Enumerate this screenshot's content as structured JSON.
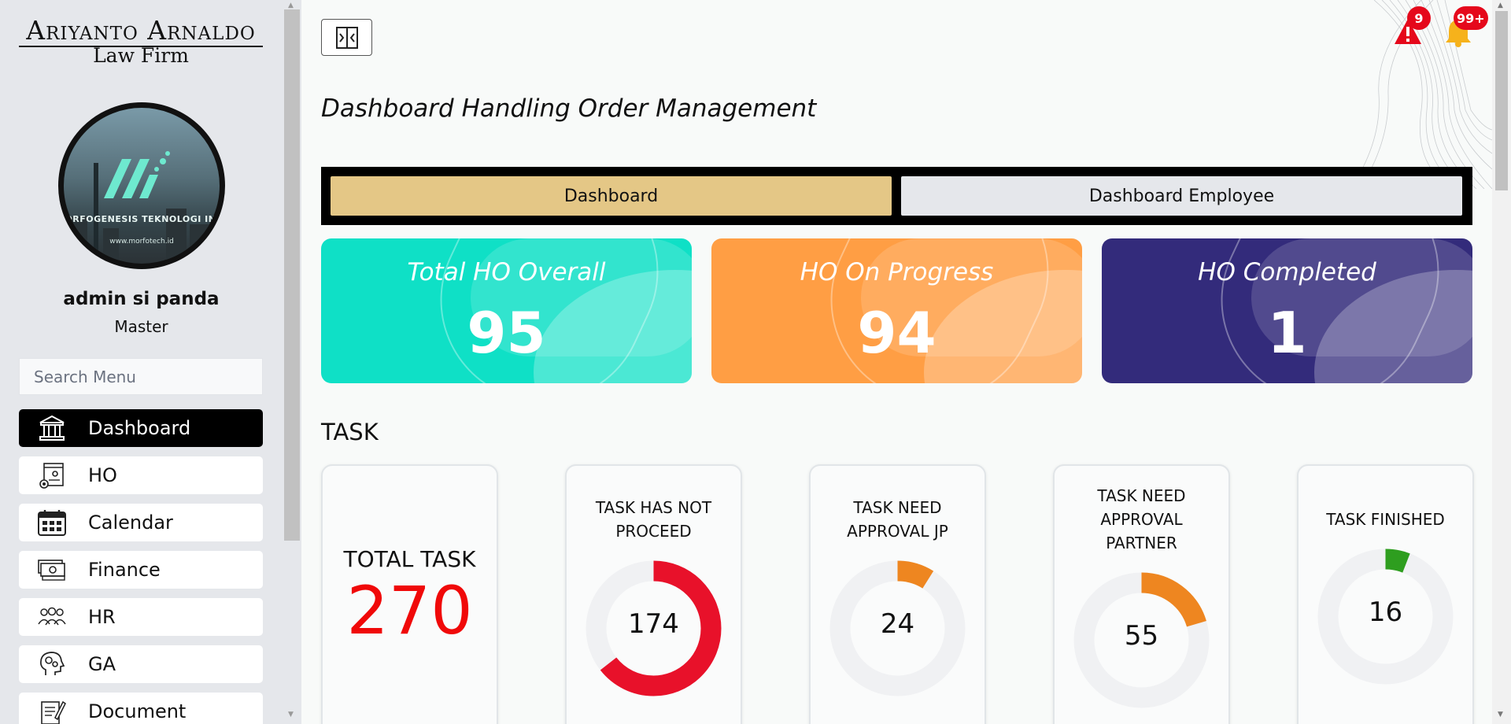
{
  "brand": {
    "line1": "Ariyanto Arnaldo",
    "line2": "Law Firm"
  },
  "avatar": {
    "company": "MORFOGENESIS TEKNOLOGI INDONESIA",
    "url": "www.morfotech.id"
  },
  "user": {
    "name": "admin si panda",
    "role": "Master"
  },
  "search": {
    "placeholder": "Search Menu"
  },
  "nav": [
    {
      "label": "Dashboard",
      "icon": "bank-icon",
      "active": true
    },
    {
      "label": "HO",
      "icon": "web-settings-icon"
    },
    {
      "label": "Calendar",
      "icon": "calendar-icon"
    },
    {
      "label": "Finance",
      "icon": "money-icon"
    },
    {
      "label": "HR",
      "icon": "people-icon"
    },
    {
      "label": "GA",
      "icon": "head-gears-icon"
    },
    {
      "label": "Document",
      "icon": "document-icon"
    }
  ],
  "header": {
    "title": "Dashboard Handling Order Management",
    "alerts_count": "9",
    "notifications_count": "99+"
  },
  "tabs": [
    {
      "label": "Dashboard",
      "active": true
    },
    {
      "label": "Dashboard Employee"
    }
  ],
  "stats": [
    {
      "title": "Total HO Overall",
      "value": "95",
      "color": "#0fe0c6"
    },
    {
      "title": "HO On Progress",
      "value": "94",
      "color": "#ff9e44"
    },
    {
      "title": "HO Completed",
      "value": "1",
      "color": "#332b7b"
    }
  ],
  "task": {
    "heading": "TASK",
    "total_label": "TOTAL TASK",
    "total_value": "270",
    "cards": [
      {
        "title": [
          "TASK HAS NOT",
          "PROCEED"
        ],
        "value": "174",
        "fraction": 0.644,
        "color": "#e8112a"
      },
      {
        "title": [
          "TASK NEED",
          "APPROVAL JP"
        ],
        "value": "24",
        "fraction": 0.089,
        "color": "#ee8620"
      },
      {
        "title": [
          "TASK NEED",
          "APPROVAL",
          "PARTNER"
        ],
        "value": "55",
        "fraction": 0.204,
        "color": "#ee8620"
      },
      {
        "title": [
          "TASK FINISHED"
        ],
        "value": "16",
        "fraction": 0.059,
        "color": "#2e9e1f"
      }
    ]
  }
}
